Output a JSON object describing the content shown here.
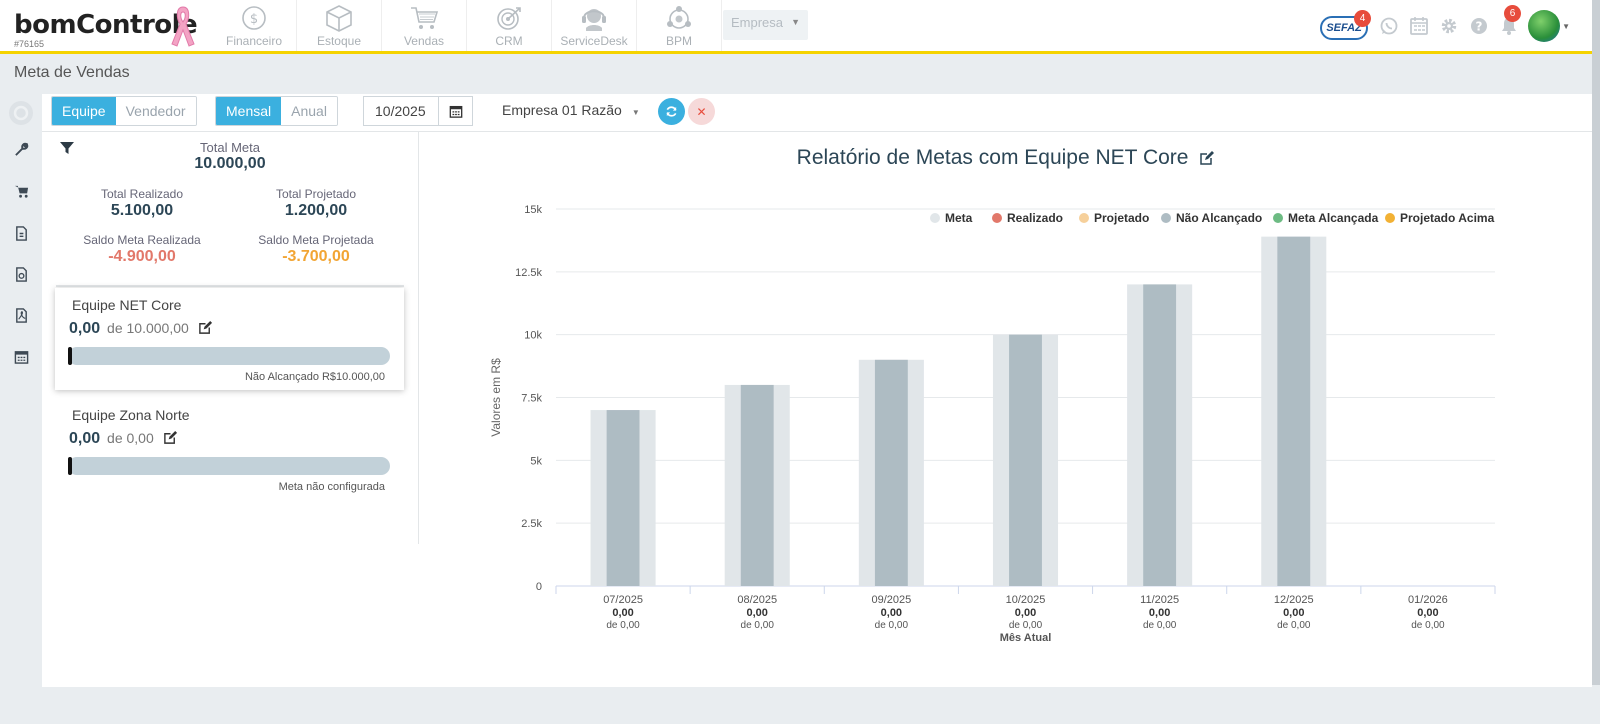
{
  "app": {
    "logo_text": "bomControle",
    "account_code": "#76165",
    "modules": [
      {
        "label": "Financeiro",
        "icon": "dollar-coin-icon"
      },
      {
        "label": "Estoque",
        "icon": "box-icon"
      },
      {
        "label": "Vendas",
        "icon": "cart-icon"
      },
      {
        "label": "CRM",
        "icon": "target-icon"
      },
      {
        "label": "ServiceDesk",
        "icon": "headset-icon"
      },
      {
        "label": "BPM",
        "icon": "process-icon"
      }
    ],
    "company_select": "Empresa",
    "sefaz_label": "SEFAZ",
    "sefaz_badge": "4",
    "notification_badge": "6",
    "accent_color": "#3bb0df",
    "top_border_color": "#f5d300"
  },
  "page": {
    "title": "Meta de Vendas"
  },
  "filters": {
    "group_by": [
      {
        "label": "Equipe",
        "active": true
      },
      {
        "label": "Vendedor",
        "active": false
      }
    ],
    "period": [
      {
        "label": "Mensal",
        "active": true
      },
      {
        "label": "Anual",
        "active": false
      }
    ],
    "date": "10/2025",
    "company": "Empresa 01 Razão"
  },
  "summary": {
    "total_meta_label": "Total Meta",
    "total_meta": "10.000,00",
    "total_realizado_label": "Total Realizado",
    "total_realizado": "5.100,00",
    "total_projetado_label": "Total Projetado",
    "total_projetado": "1.200,00",
    "saldo_realizada_label": "Saldo Meta Realizada",
    "saldo_realizada": "-4.900,00",
    "saldo_projetada_label": "Saldo Meta Projetada",
    "saldo_projetada": "-3.700,00"
  },
  "teams": [
    {
      "name": "Equipe NET Core",
      "value": "0,00",
      "target": "de 10.000,00",
      "status": "Não Alcançado R$10.000,00",
      "progress": 0,
      "selected": true
    },
    {
      "name": "Equipe Zona Norte",
      "value": "0,00",
      "target": "de 0,00",
      "status": "Meta não configurada",
      "progress": 0,
      "selected": false
    }
  ],
  "chart_title": "Relatório de Metas com Equipe NET Core",
  "chart_data": {
    "type": "bar",
    "ylabel": "Valores em R$",
    "xlabel": "Mês Atual",
    "ylim": [
      0,
      15000
    ],
    "yticks": [
      "0",
      "2.5k",
      "5k",
      "7.5k",
      "10k",
      "12.5k",
      "15k"
    ],
    "ytick_values": [
      0,
      2500,
      5000,
      7500,
      10000,
      12500,
      15000
    ],
    "categories": [
      "07/2025",
      "08/2025",
      "09/2025",
      "10/2025",
      "11/2025",
      "12/2025",
      "01/2026"
    ],
    "category_values": [
      "0,00",
      "0,00",
      "0,00",
      "0,00",
      "0,00",
      "0,00",
      "0,00"
    ],
    "category_targets": [
      "de 0,00",
      "de 0,00",
      "de 0,00",
      "de 0,00",
      "de 0,00",
      "de 0,00",
      "de 0,00"
    ],
    "highlight_category": "10/2025",
    "legend_position": "top-right",
    "grid": true,
    "legend": [
      {
        "name": "Meta",
        "color": "#e1e6e9"
      },
      {
        "name": "Realizado",
        "color": "#e2786a"
      },
      {
        "name": "Projetado",
        "color": "#f6d09b"
      },
      {
        "name": "Não Alcançado",
        "color": "#aebcc3"
      },
      {
        "name": "Meta Alcançada",
        "color": "#6dbb83"
      },
      {
        "name": "Projetado Acima",
        "color": "#f2b134"
      }
    ],
    "series": [
      {
        "name": "Meta",
        "color": "#e1e6e9",
        "values": [
          7000,
          8000,
          9000,
          10000,
          12000,
          13900,
          0
        ]
      },
      {
        "name": "Não Alcançado",
        "color": "#aebcc3",
        "values": [
          7000,
          8000,
          9000,
          10000,
          12000,
          13900,
          0
        ]
      }
    ]
  }
}
